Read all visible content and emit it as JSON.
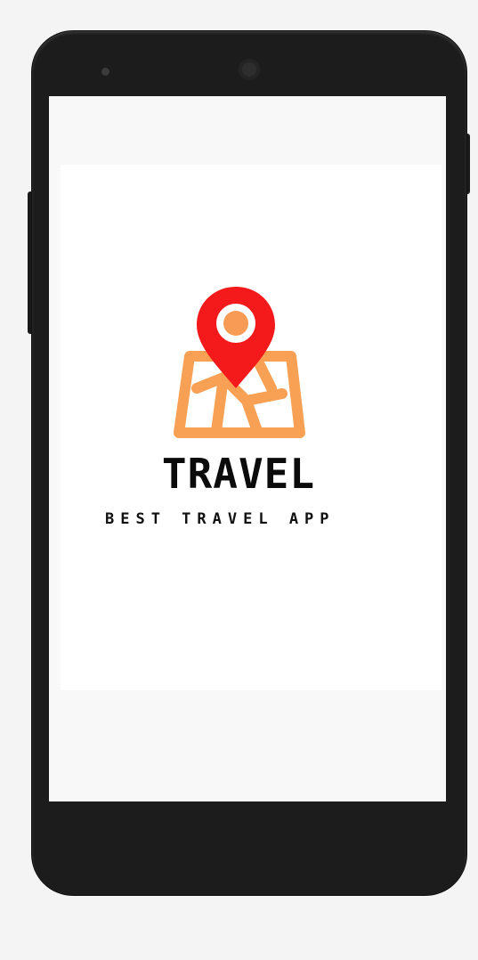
{
  "app": {
    "title": "TRAVEL",
    "subtitle": "BEST TRAVEL APP"
  },
  "logo": {
    "icon": "map-pin-icon",
    "pin_color": "#f4191b",
    "pin_dot_color": "#f89b55",
    "map_color": "#f8a054"
  },
  "device": {
    "frame_color": "#1c1c1c"
  }
}
